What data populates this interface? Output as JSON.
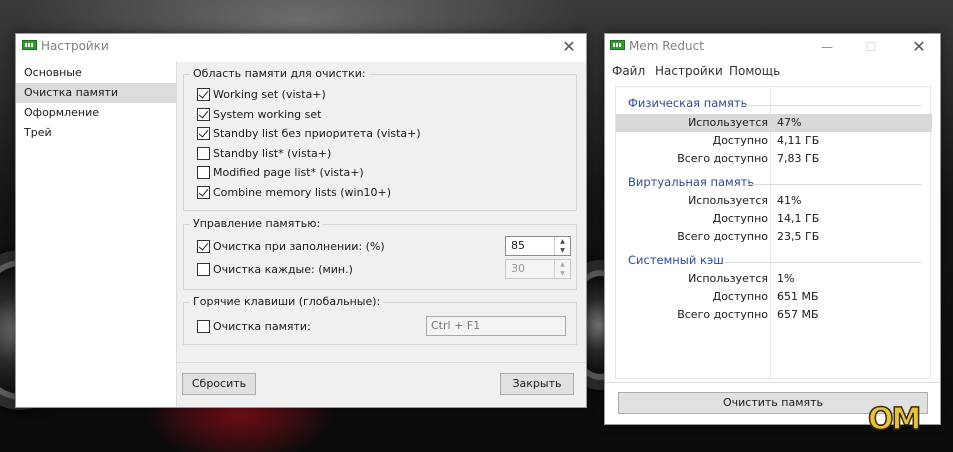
{
  "settings_window": {
    "title": "Настройки",
    "close_glyph": "✕",
    "nav": [
      "Основные",
      "Очистка памяти",
      "Оформление",
      "Трей"
    ],
    "active_nav_index": 1,
    "group_regions": {
      "title": "Область памяти для очистки:",
      "options": [
        {
          "label": "Working set (vista+)",
          "checked": true
        },
        {
          "label": "System working set",
          "checked": true
        },
        {
          "label": "Standby list без приоритета (vista+)",
          "checked": true
        },
        {
          "label": "Standby list* (vista+)",
          "checked": false
        },
        {
          "label": "Modified page list* (vista+)",
          "checked": false
        },
        {
          "label": "Combine memory lists (win10+)",
          "checked": true
        }
      ]
    },
    "group_management": {
      "title": "Управление памятью:",
      "fill_label": "Очистка при заполнении: (%)",
      "fill_checked": true,
      "fill_value": "85",
      "interval_label": "Очистка каждые: (мин.)",
      "interval_checked": false,
      "interval_value": "30"
    },
    "group_hotkeys": {
      "title": "Горячие клавиши (глобальные):",
      "clean_label": "Очистка памяти:",
      "clean_checked": false,
      "hotkey_value": "Ctrl + F1"
    },
    "reset_button": "Сбросить",
    "close_button": "Закрыть"
  },
  "memreduct_window": {
    "title": "Mem Reduct",
    "minimize_glyph": "—",
    "maximize_glyph": "☐",
    "close_glyph": "✕",
    "menu": [
      "Файл",
      "Настройки",
      "Помощь"
    ],
    "sections": [
      {
        "title": "Физическая память",
        "rows": [
          {
            "key": "Используется",
            "value": "47%"
          },
          {
            "key": "Доступно",
            "value": "4,11 ГБ"
          },
          {
            "key": "Всего доступно",
            "value": "7,83 ГБ"
          }
        ]
      },
      {
        "title": "Виртуальная память",
        "rows": [
          {
            "key": "Используется",
            "value": "41%"
          },
          {
            "key": "Доступно",
            "value": "14,1 ГБ"
          },
          {
            "key": "Всего доступно",
            "value": "23,5 ГБ"
          }
        ]
      },
      {
        "title": "Системный кэш",
        "rows": [
          {
            "key": "Используется",
            "value": "1%"
          },
          {
            "key": "Доступно",
            "value": "651 МБ"
          },
          {
            "key": "Всего доступно",
            "value": "657 МБ"
          }
        ]
      }
    ],
    "clean_button": "Очистить память"
  },
  "watermark": "OM"
}
